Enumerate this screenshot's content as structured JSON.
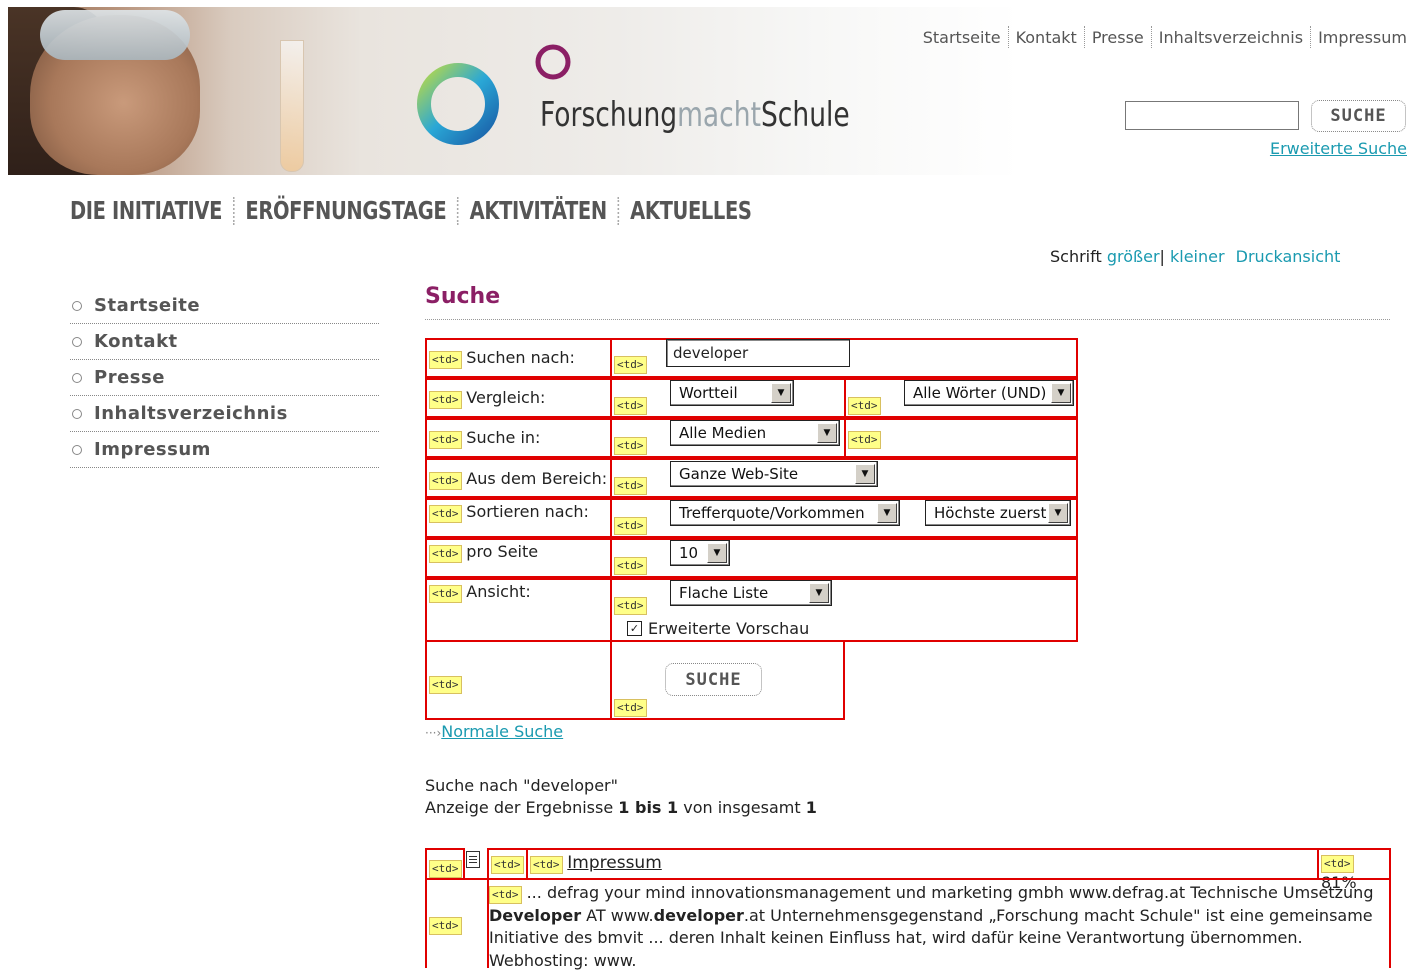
{
  "header": {
    "logo_text_a": "Forschung",
    "logo_text_b": "macht",
    "logo_text_c": "Schule",
    "top_nav": [
      "Startseite",
      "Kontakt",
      "Presse",
      "Inhaltsverzeichnis",
      "Impressum"
    ],
    "search_placeholder": "",
    "search_button": "SUCHE",
    "advanced_search": "Erweiterte Suche"
  },
  "main_nav": [
    "DIE INITIATIVE",
    "ERÖFFNUNGSTAGE",
    "AKTIVITÄTEN",
    "AKTUELLES"
  ],
  "tools": {
    "font_label": "Schrift",
    "bigger": "größer",
    "sep": "|",
    "smaller": "kleiner",
    "print": "Druckansicht"
  },
  "sidebar": {
    "items": [
      "Startseite",
      "Kontakt",
      "Presse",
      "Inhaltsverzeichnis",
      "Impressum"
    ]
  },
  "page": {
    "title": "Suche",
    "td_tag": "<td>"
  },
  "form": {
    "search_for_label": "Suchen nach:",
    "search_for_value": "developer",
    "compare_label": "Vergleich:",
    "compare_value": "Wortteil",
    "words_value": "Alle Wörter (UND)",
    "search_in_label": "Suche in:",
    "search_in_value": "Alle Medien",
    "area_label": "Aus dem Bereich:",
    "area_value": "Ganze Web-Site",
    "sort_label": "Sortieren nach:",
    "sort_value": "Trefferquote/Vorkommen",
    "order_value": "Höchste zuerst",
    "per_page_label": "pro Seite",
    "per_page_value": "10",
    "view_label": "Ansicht:",
    "view_value": "Flache Liste",
    "preview_label": "Erweiterte Vorschau",
    "submit_label": "SUCHE",
    "normal_search": "Normale Suche"
  },
  "results": {
    "query_line": "Suche nach \"developer\"",
    "showing_prefix": "Anzeige der Ergebnisse ",
    "range": "1 bis 1",
    "total_prefix": " von insgesamt ",
    "total": "1",
    "item": {
      "title": "Impressum",
      "score": "81%",
      "snippet_1": "... defrag your mind innovationsmanagement und marketing gmbh www.defrag.at Technische Umsetzung",
      "snippet_hit_1": "Developer",
      "snippet_2": " AT www.",
      "snippet_hit_2": "developer",
      "snippet_3": ".at Unternehmensgegenstand „Forschung macht Schule\" ist eine gemeinsame",
      "snippet_4": "Initiative des bmvit ... deren Inhalt keinen Einfluss hat, wird dafür keine Verantwortung übernommen.",
      "snippet_5": "Webhosting: www."
    }
  }
}
